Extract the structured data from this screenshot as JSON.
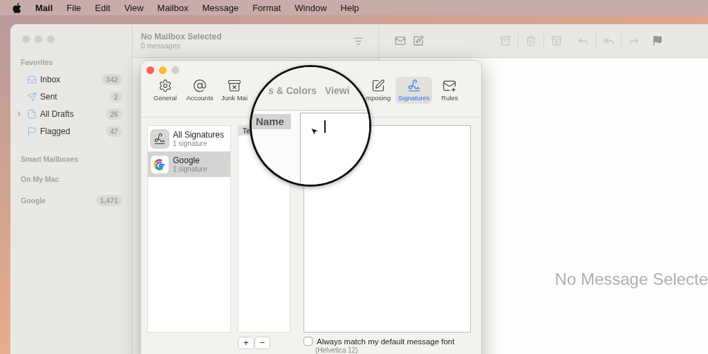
{
  "menu_bar": {
    "app_name": "Mail",
    "items": [
      "File",
      "Edit",
      "View",
      "Mailbox",
      "Message",
      "Format",
      "Window",
      "Help"
    ]
  },
  "mail_window": {
    "sidebar": {
      "favorites_title": "Favorites",
      "mailboxes": [
        {
          "kind": "inbox",
          "name": "Inbox",
          "count": "342"
        },
        {
          "kind": "sent",
          "name": "Sent",
          "count": "2"
        },
        {
          "kind": "drafts",
          "name": "All Drafts",
          "count": "26",
          "expanded": false
        },
        {
          "kind": "flagged",
          "name": "Flagged",
          "count": "47"
        }
      ],
      "sections": [
        {
          "title": "Smart Mailboxes"
        },
        {
          "title": "On My Mac"
        },
        {
          "title": "Google",
          "count": "1,471"
        }
      ]
    },
    "message_list": {
      "title": "No Mailbox Selected",
      "subtitle": "0 messages"
    },
    "viewer": {
      "empty_text": "No Message Selecte"
    }
  },
  "preferences": {
    "toolbar": [
      {
        "kind": "gear",
        "label": "General",
        "selected": false
      },
      {
        "kind": "at",
        "label": "Accounts",
        "selected": false
      },
      {
        "kind": "junk",
        "label": "Junk Mai",
        "selected": false
      },
      {
        "kind": "compose",
        "label": "mposing",
        "selected": false
      },
      {
        "kind": "signature",
        "label": "Signatures",
        "selected": true
      },
      {
        "kind": "rules",
        "label": "Rules",
        "selected": false
      }
    ],
    "accounts": [
      {
        "kind": "signature",
        "name": "All Signatures",
        "subtitle": "1 signature",
        "selected": false
      },
      {
        "kind": "google",
        "name": "Google",
        "subtitle": "1 signature",
        "selected": true
      }
    ],
    "signature_list_header": "Te",
    "add_remove": [
      "+",
      "−"
    ],
    "match_font": {
      "label": "Always match my default message font",
      "checked": false,
      "note": "(Helvetica 12)"
    },
    "magnifier": {
      "toolbar_texts": [
        "s & Colors",
        "Viewi"
      ],
      "column_header": "Name"
    }
  }
}
